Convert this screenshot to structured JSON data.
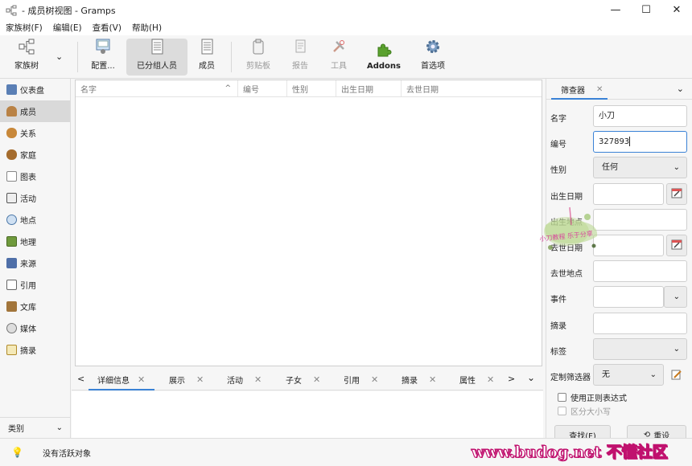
{
  "window": {
    "title": " - 成员树视图 - Gramps",
    "minimize": "—",
    "maximize": "☐",
    "close": "✕"
  },
  "menu": [
    "家族树(F)",
    "编辑(E)",
    "查看(V)",
    "帮助(H)"
  ],
  "toolbar": {
    "family_tree": "家族树",
    "configure": "配置...",
    "grouped_people": "已分组人员",
    "people": "成员",
    "clipboard": "剪贴板",
    "reports": "报告",
    "tools": "工具",
    "addons": "Addons",
    "preferences": "首选项"
  },
  "sidebar": {
    "items": [
      "仪表盘",
      "成员",
      "关系",
      "家庭",
      "图表",
      "活动",
      "地点",
      "地理",
      "来源",
      "引用",
      "文库",
      "媒体",
      "摘录"
    ],
    "active_index": 1,
    "category": "类别"
  },
  "list": {
    "columns": [
      "名字",
      "编号",
      "性别",
      "出生日期",
      "去世日期"
    ],
    "sort_indicator": "^"
  },
  "bottom_tabs": {
    "tabs": [
      "详细信息",
      "展示",
      "活动",
      "子女",
      "引用",
      "摘录",
      "属性"
    ],
    "active_index": 0,
    "prev": "<",
    "next": ">",
    "menu": "⌄"
  },
  "filter": {
    "tab_label": "筛查器",
    "name_label": "名字",
    "name_value": "小刀",
    "id_label": "编号",
    "id_value": "327893",
    "gender_label": "性别",
    "gender_value": "任何",
    "birth_date_label": "出生日期",
    "birth_place_label": "出生地点",
    "death_date_label": "去世日期",
    "death_place_label": "去世地点",
    "event_label": "事件",
    "note_label": "摘录",
    "tag_label": "标签",
    "custom_filter_label": "定制筛选器",
    "custom_filter_value": "无",
    "regex_label": "使用正则表达式",
    "case_label": "区分大小写",
    "find_button": "查找(F)",
    "reset_button": "重设"
  },
  "status": {
    "text": "没有活跃对象"
  },
  "watermark": {
    "stamp_text": "小刀教程 乐于分享",
    "site_text": "www.budog.net 不懂社区"
  }
}
